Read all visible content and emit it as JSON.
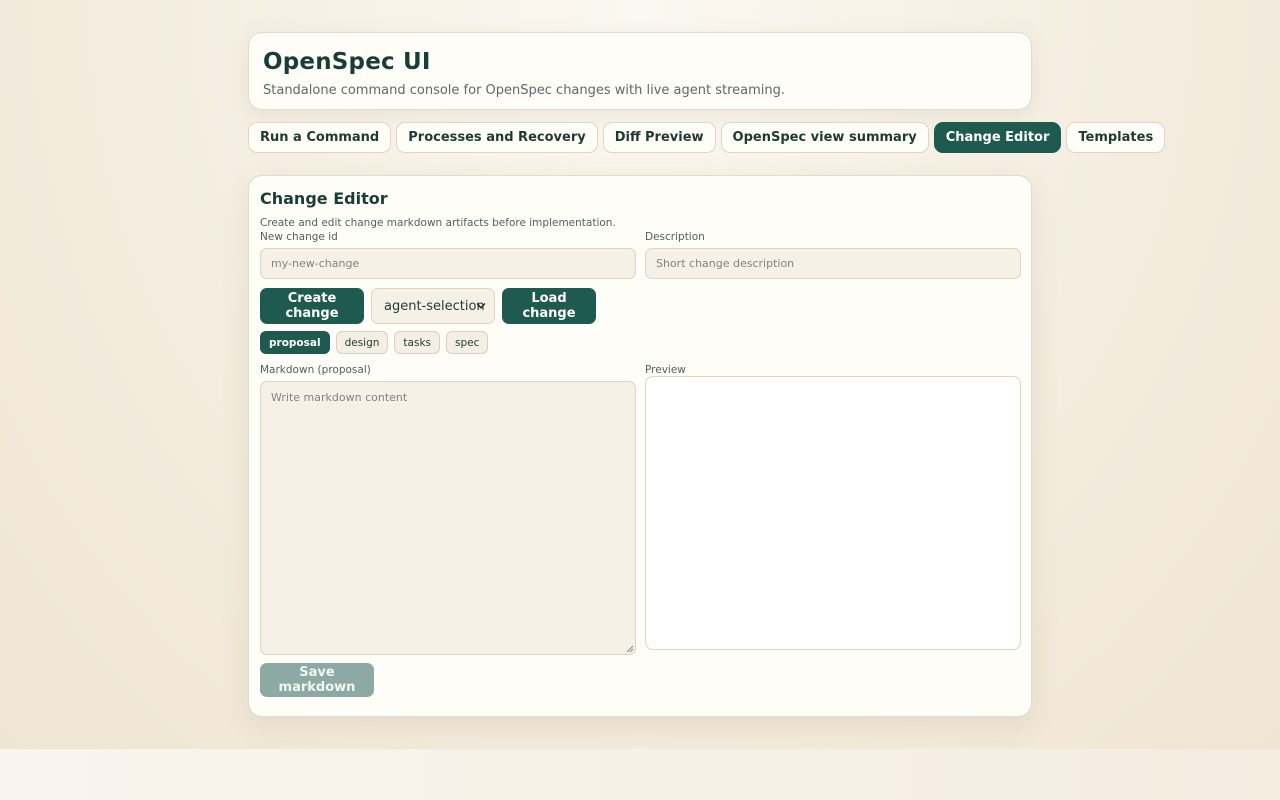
{
  "header": {
    "title": "OpenSpec UI",
    "subtitle": "Standalone command console for OpenSpec changes with live agent streaming."
  },
  "tabs": [
    {
      "label": "Run a Command",
      "active": false
    },
    {
      "label": "Processes and Recovery",
      "active": false
    },
    {
      "label": "Diff Preview",
      "active": false
    },
    {
      "label": "OpenSpec view summary",
      "active": false
    },
    {
      "label": "Change Editor",
      "active": true
    },
    {
      "label": "Templates",
      "active": false
    }
  ],
  "editor": {
    "title": "Change Editor",
    "description": "Create and edit change markdown artifacts before implementation.",
    "new_id_label": "New change id",
    "new_id_placeholder": "my-new-change",
    "description_label": "Description",
    "description_placeholder": "Short change description",
    "create_button": "Create change",
    "select_value": "agent-selection",
    "load_button": "Load change",
    "artifacts": [
      {
        "label": "proposal",
        "active": true
      },
      {
        "label": "design",
        "active": false
      },
      {
        "label": "tasks",
        "active": false
      },
      {
        "label": "spec",
        "active": false
      }
    ],
    "markdown_label": "Markdown (proposal)",
    "markdown_placeholder": "Write markdown content",
    "preview_label": "Preview",
    "save_button": "Save markdown",
    "save_enabled": false
  },
  "colors": {
    "accent": "#1e5a4f",
    "disabled": "#8ca9a3",
    "card": "#fffdf7",
    "input": "#f6f1e6"
  },
  "icons": {
    "select_arrow": "chevron-down-icon",
    "textarea_grip": "resize-grip-icon"
  }
}
